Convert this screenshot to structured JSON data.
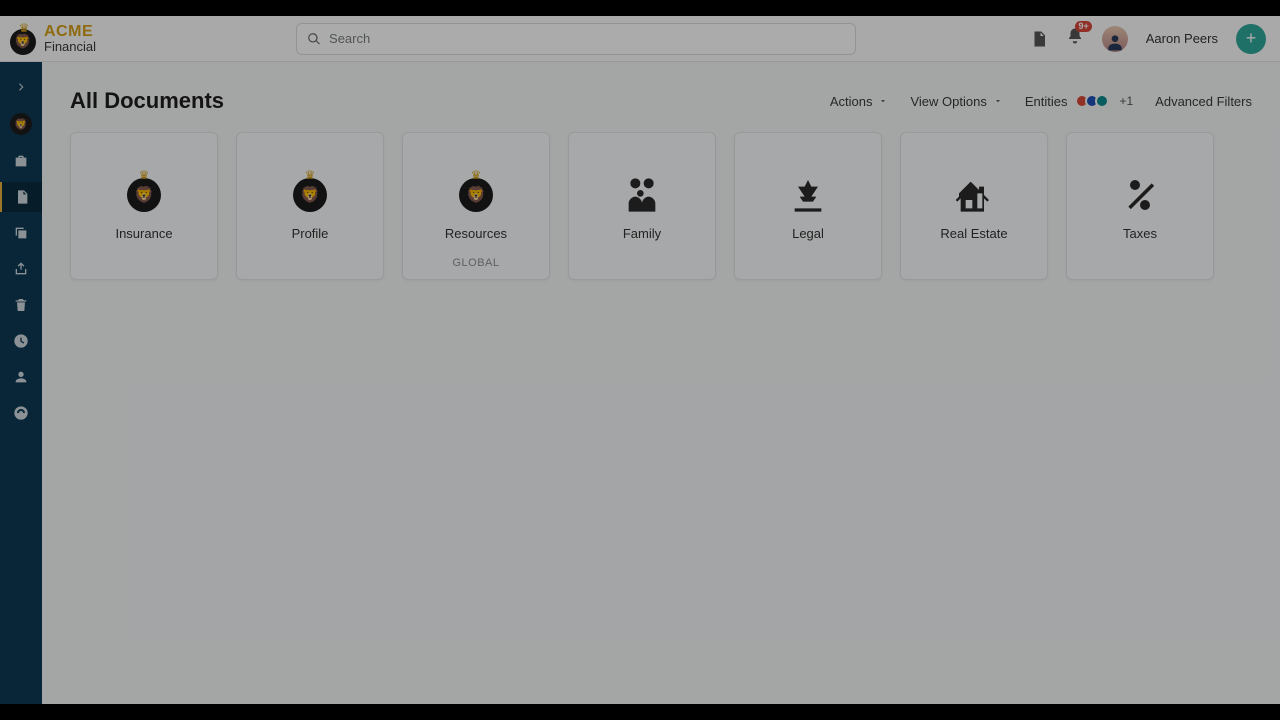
{
  "brand": {
    "top": "ACME",
    "bottom": "Financial"
  },
  "search": {
    "placeholder": "Search"
  },
  "notifications": {
    "badge": "9+"
  },
  "user": {
    "name": "Aaron Peers"
  },
  "page": {
    "title": "All Documents"
  },
  "controls": {
    "actions": "Actions",
    "view_options": "View Options",
    "entities": "Entities",
    "entities_extra": "+1",
    "advanced_filters": "Advanced Filters",
    "entity_colors": [
      "#d9483b",
      "#1e4fb8",
      "#0b8a8f"
    ]
  },
  "folders": [
    {
      "label": "Insurance",
      "icon": "brand",
      "sub": ""
    },
    {
      "label": "Profile",
      "icon": "brand",
      "sub": ""
    },
    {
      "label": "Resources",
      "icon": "brand",
      "sub": "GLOBAL"
    },
    {
      "label": "Family",
      "icon": "family",
      "sub": ""
    },
    {
      "label": "Legal",
      "icon": "legal",
      "sub": ""
    },
    {
      "label": "Real Estate",
      "icon": "realestate",
      "sub": ""
    },
    {
      "label": "Taxes",
      "icon": "taxes",
      "sub": ""
    }
  ],
  "sidebar": [
    {
      "name": "collapse",
      "icon": "chevrons"
    },
    {
      "name": "brand",
      "icon": "brand"
    },
    {
      "name": "briefcase",
      "icon": "briefcase"
    },
    {
      "name": "documents",
      "icon": "document",
      "active": true
    },
    {
      "name": "copy",
      "icon": "copy"
    },
    {
      "name": "share",
      "icon": "share"
    },
    {
      "name": "trash",
      "icon": "trash"
    },
    {
      "name": "recent",
      "icon": "clock"
    },
    {
      "name": "user",
      "icon": "user"
    },
    {
      "name": "support",
      "icon": "support"
    }
  ]
}
